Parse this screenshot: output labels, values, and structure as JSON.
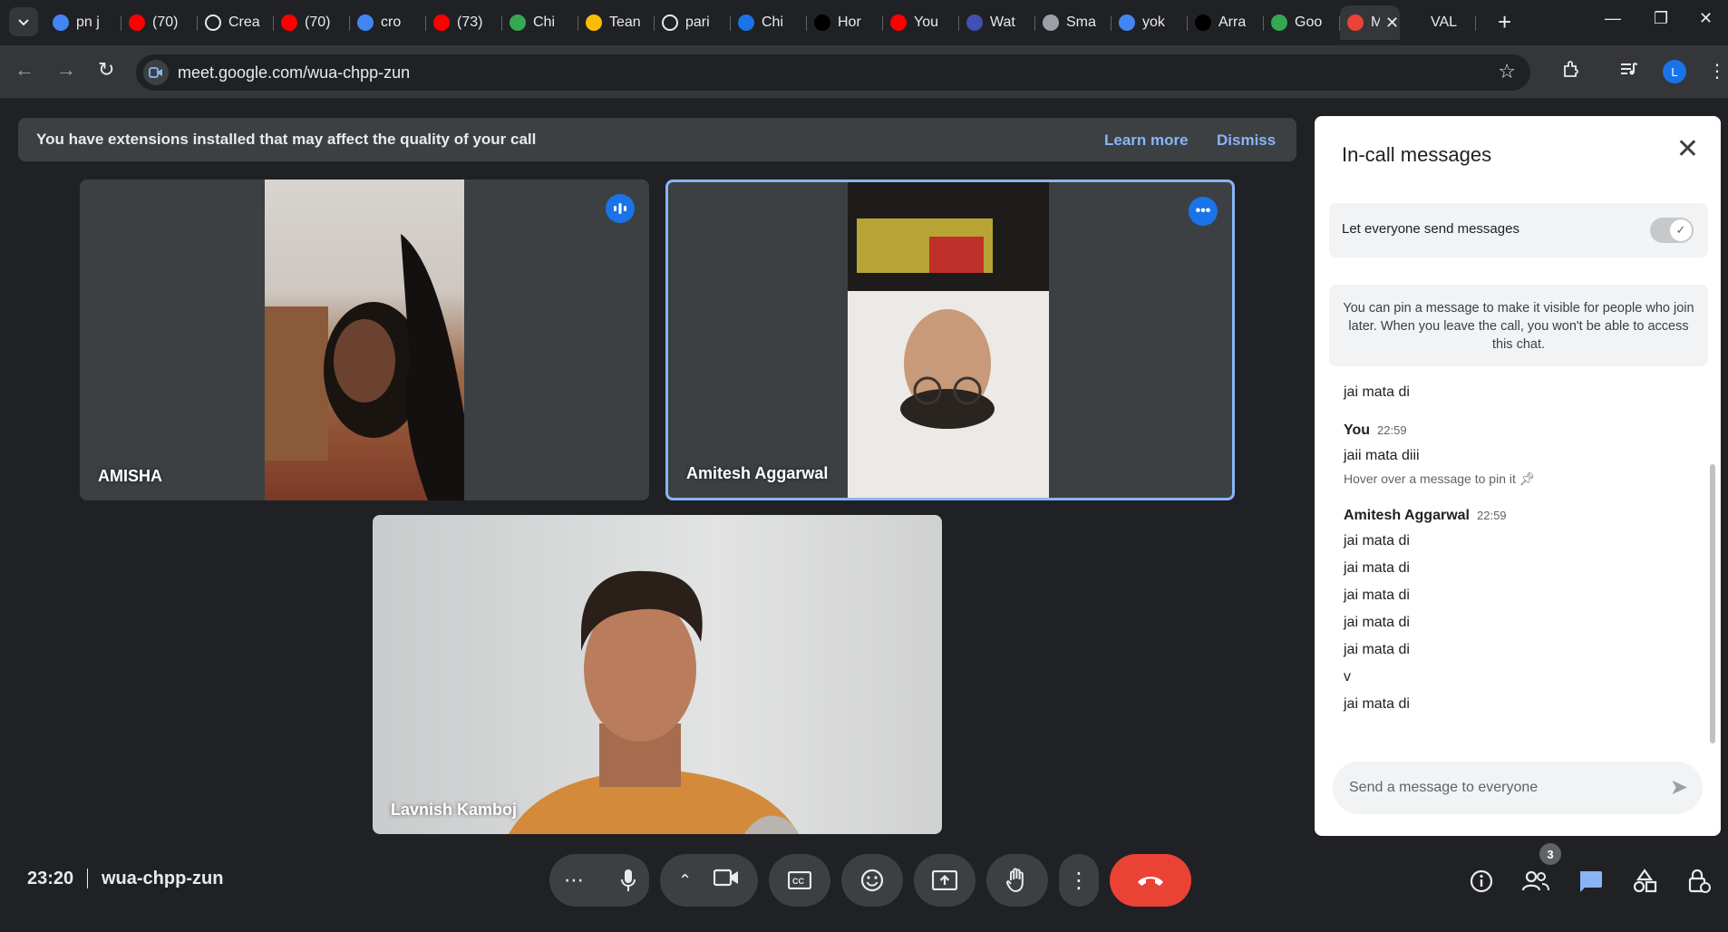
{
  "browser": {
    "tabs": [
      {
        "title": "pn j",
        "icon": "google-icon",
        "color": "#4285f4"
      },
      {
        "title": "(70)",
        "icon": "youtube-icon",
        "color": "#ff0000"
      },
      {
        "title": "Crea",
        "icon": "openai-icon",
        "color": "#ffffff"
      },
      {
        "title": "(70)",
        "icon": "youtube-icon",
        "color": "#ff0000"
      },
      {
        "title": "cro",
        "icon": "google-icon",
        "color": "#4285f4"
      },
      {
        "title": "(73)",
        "icon": "youtube-icon",
        "color": "#ff0000"
      },
      {
        "title": "Chi",
        "icon": "chrome-icon",
        "color": "#34a853"
      },
      {
        "title": "Tean",
        "icon": "teams-icon",
        "color": "#fbbc04"
      },
      {
        "title": "pari",
        "icon": "openai-icon",
        "color": "#ffffff"
      },
      {
        "title": "Chi",
        "icon": "chat-icon",
        "color": "#1a73e8"
      },
      {
        "title": "Hor",
        "icon": "x-icon",
        "color": "#000000"
      },
      {
        "title": "You",
        "icon": "youtube-music-icon",
        "color": "#ff0000"
      },
      {
        "title": "Wat",
        "icon": "h-icon",
        "color": "#3f51b5"
      },
      {
        "title": "Sma",
        "icon": "bee-icon",
        "color": "#9aa0a6"
      },
      {
        "title": "yok",
        "icon": "google-icon",
        "color": "#4285f4"
      },
      {
        "title": "Arra",
        "icon": "notion-icon",
        "color": "#000000"
      },
      {
        "title": "Goo",
        "icon": "gdocs-icon",
        "color": "#34a853"
      }
    ],
    "active_tab": {
      "title": "M",
      "icon": "meet-record-icon",
      "color": "#ea4335"
    },
    "extra_tab": {
      "title": "VAL",
      "icon": "valorant-icon"
    },
    "url": "meet.google.com/wua-chpp-zun",
    "profile_initial": "L"
  },
  "banner": {
    "text": "You have extensions installed that may affect the quality of your call",
    "learn_more": "Learn more",
    "dismiss": "Dismiss"
  },
  "participants": [
    {
      "name": "AMISHA",
      "badge_icon": "audio-level-icon",
      "speaking": false
    },
    {
      "name": "Amitesh Aggarwal",
      "badge_icon": "more-options-icon",
      "speaking": true
    },
    {
      "name": "Lavnish Kamboj",
      "badge_icon": "",
      "speaking": false
    }
  ],
  "chat": {
    "title": "In-call messages",
    "toggle_label": "Let everyone send messages",
    "toggle_on": true,
    "pin_info": "You can pin a message to make it visible for people who join later. When you leave the call, you won't be able to access this chat.",
    "first_message": "jai mata di",
    "group1": {
      "sender": "You",
      "time": "22:59",
      "messages": [
        "jaii mata diii"
      ],
      "hint": "Hover over a message to pin it"
    },
    "group2": {
      "sender": "Amitesh Aggarwal",
      "time": "22:59",
      "messages": [
        "jai mata di",
        "jai mata di",
        "jai mata di",
        "jai mata di",
        "jai mata di",
        "v",
        "jai mata di"
      ]
    },
    "input_placeholder": "Send a message to everyone"
  },
  "bottom": {
    "time": "23:20",
    "meeting_code": "wua-chpp-zun",
    "people_count": "3"
  }
}
